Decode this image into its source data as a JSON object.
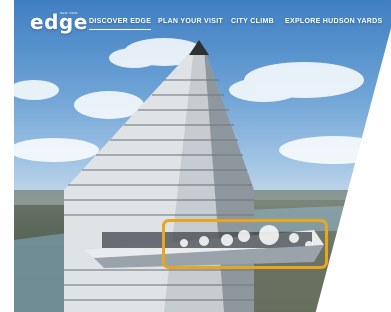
{
  "brand": {
    "logo_text": "edge",
    "logo_sub": "NEW YORK"
  },
  "nav": {
    "items": [
      {
        "label": "DISCOVER EDGE",
        "active": true
      },
      {
        "label": "PLAN YOUR VISIT",
        "active": false
      },
      {
        "label": "CITY CLIMB",
        "active": false
      },
      {
        "label": "EXPLORE HUDSON YARDS",
        "active": false
      }
    ]
  },
  "colors": {
    "highlight": "#e8a51e",
    "sky": "#3f7fc2",
    "nav_text": "#ffffff"
  }
}
